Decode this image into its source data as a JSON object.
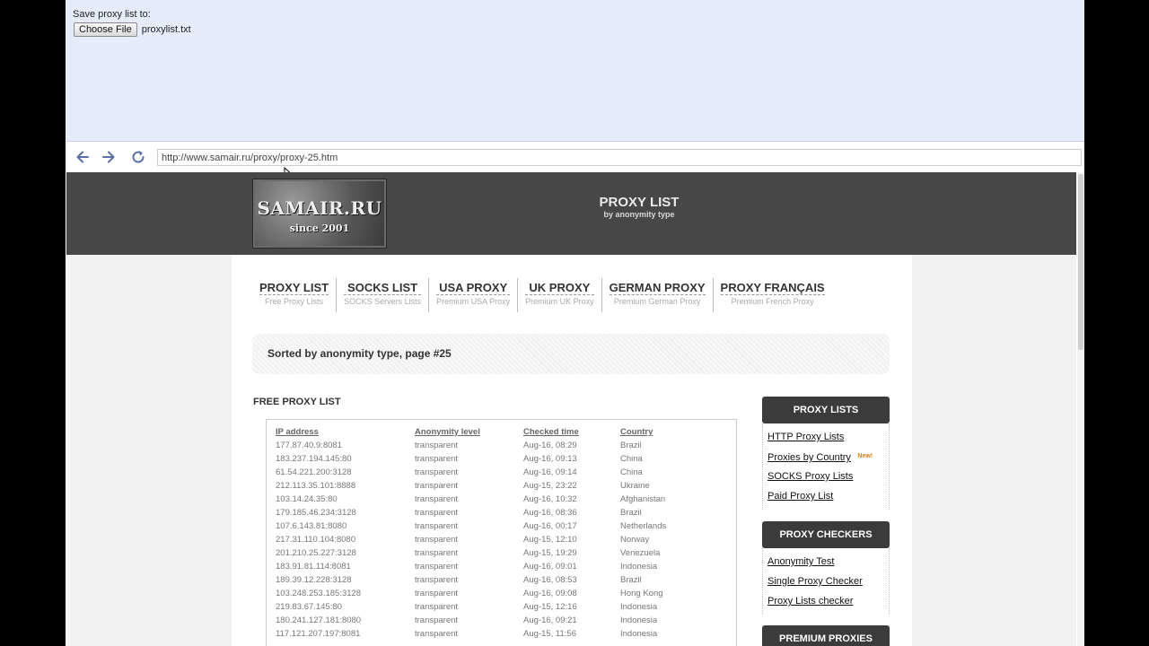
{
  "upload": {
    "label": "Save proxy list to:",
    "button": "Choose File",
    "filename": "proxylist.txt"
  },
  "browser": {
    "url": "http://www.samair.ru/proxy/proxy-25.htm"
  },
  "header": {
    "logo_main": "SAMAIR.RU",
    "logo_sub": "since 2001",
    "title": "PROXY LIST",
    "subtitle": "by anonymity type"
  },
  "menu": [
    {
      "title": "PROXY LIST",
      "sub": "Free Proxy Lists"
    },
    {
      "title": "SOCKS LIST",
      "sub": "SOCKS Servers Lists"
    },
    {
      "title": "USA PROXY",
      "sub": "Premium USA Proxy"
    },
    {
      "title": "UK PROXY",
      "sub": "Premium UK Proxy"
    },
    {
      "title": "GERMAN PROXY",
      "sub": "Premium German Proxy"
    },
    {
      "title": "PROXY FRANÇAIS",
      "sub": "Premium French Proxy"
    }
  ],
  "sorted_text": "Sorted by anonymity type, page #25",
  "free_title": "FREE PROXY LIST",
  "table": {
    "headers": [
      "IP address",
      "Anonymity level",
      "Checked time",
      "Country"
    ],
    "rows": [
      [
        "177.87.40.9:8081",
        "transparent",
        "Aug-16, 08:29",
        "Brazil"
      ],
      [
        "183.237.194.145:80",
        "transparent",
        "Aug-16, 09:13",
        "China"
      ],
      [
        "61.54.221.200:3128",
        "transparent",
        "Aug-16, 09:14",
        "China"
      ],
      [
        "212.113.35.101:8888",
        "transparent",
        "Aug-15, 23:22",
        "Ukraine"
      ],
      [
        "103.14.24.35:80",
        "transparent",
        "Aug-16, 10:32",
        "Afghanistan"
      ],
      [
        "179.185.46.234:3128",
        "transparent",
        "Aug-16, 08:36",
        "Brazil"
      ],
      [
        "107.6.143.81:8080",
        "transparent",
        "Aug-16, 00:17",
        "Netherlands"
      ],
      [
        "217.31.110.104:8080",
        "transparent",
        "Aug-15, 12:10",
        "Norway"
      ],
      [
        "201.210.25.227:3128",
        "transparent",
        "Aug-15, 19:29",
        "Venezuela"
      ],
      [
        "183.91.81.114:8081",
        "transparent",
        "Aug-16, 09:01",
        "Indonesia"
      ],
      [
        "189.39.12.228:3128",
        "transparent",
        "Aug-16, 08:53",
        "Brazil"
      ],
      [
        "103.248.253.185:3128",
        "transparent",
        "Aug-16, 09:08",
        "Hong Kong"
      ],
      [
        "219.83.67.145:80",
        "transparent",
        "Aug-15, 12:16",
        "Indonesia"
      ],
      [
        "180.241.127.181:8080",
        "transparent",
        "Aug-16, 09:21",
        "Indonesia"
      ],
      [
        "117.121.207.197:8081",
        "transparent",
        "Aug-15, 11:56",
        "Indonesia"
      ]
    ]
  },
  "sidebar": {
    "proxy_lists": {
      "title": "PROXY LISTS",
      "links": [
        "HTTP Proxy Lists",
        "Proxies by Country",
        "SOCKS Proxy Lists",
        "Paid Proxy List"
      ],
      "new_badge": "New!"
    },
    "proxy_checkers": {
      "title": "PROXY CHECKERS",
      "links": [
        "Anonymity Test",
        "Single Proxy Checker",
        "Proxy Lists checker"
      ]
    },
    "premium": {
      "title": "PREMIUM PROXIES"
    }
  },
  "icons": [
    "back-arrow-icon",
    "forward-arrow-icon",
    "reload-icon",
    "mouse-cursor-icon"
  ],
  "colors": {
    "nav_icon": "#5a6fa8",
    "header_bg": "#474747",
    "sidebar_head": "#3b3b3b",
    "new_badge": "#e07b12"
  }
}
